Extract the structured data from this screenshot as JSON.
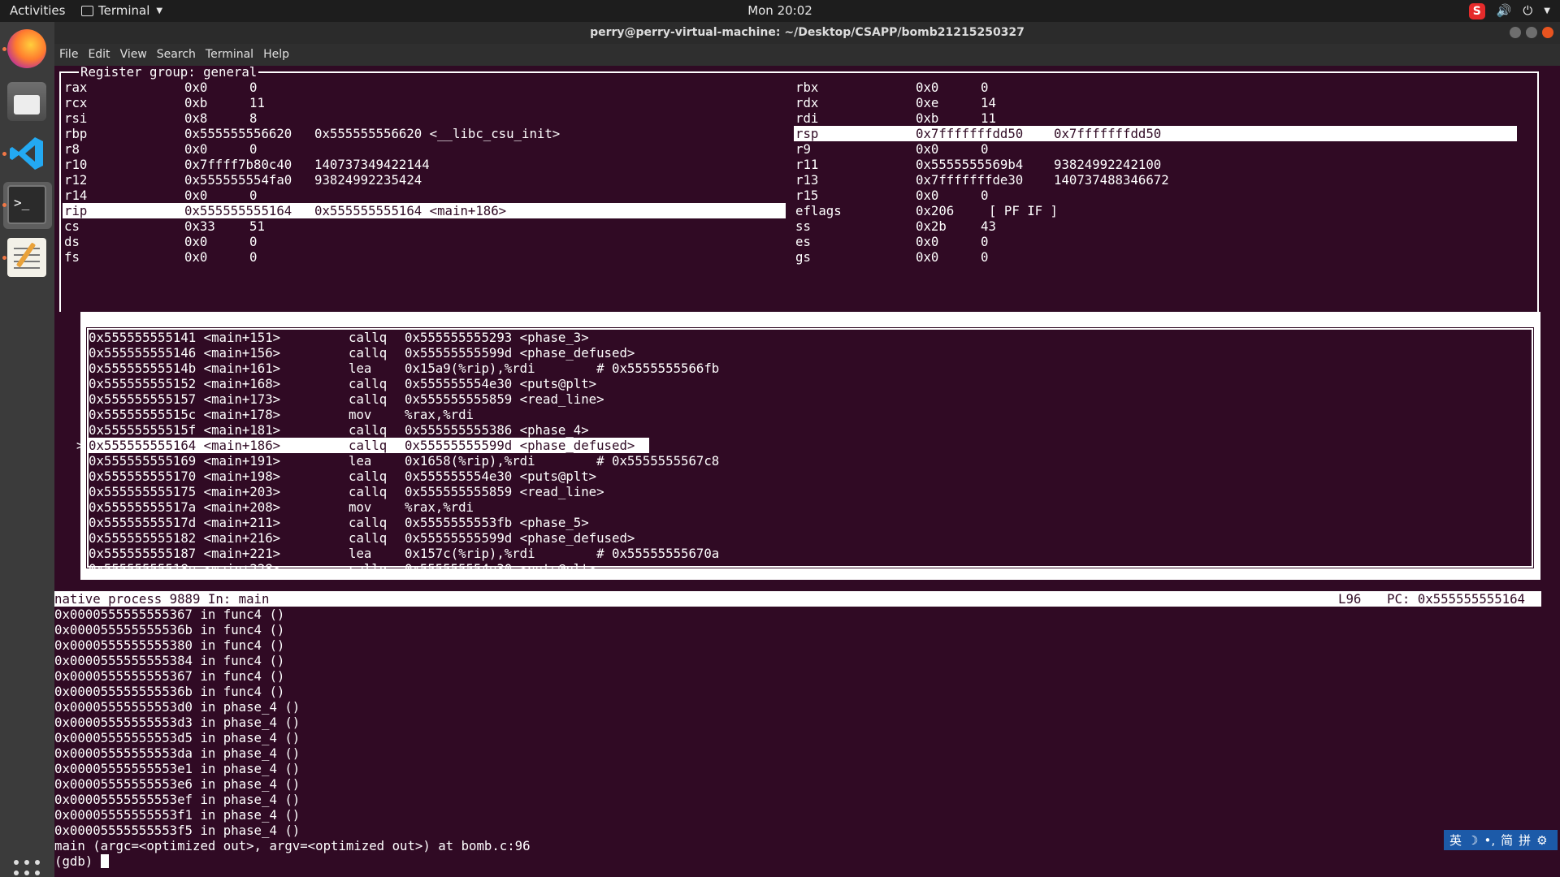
{
  "topbar": {
    "activities": "Activities",
    "app_menu": "Terminal",
    "clock": "Mon 20:02"
  },
  "window": {
    "title": "perry@perry-virtual-machine: ~/Desktop/CSAPP/bomb21215250327"
  },
  "menu": [
    "File",
    "Edit",
    "View",
    "Search",
    "Terminal",
    "Help"
  ],
  "registers": {
    "title": "Register group: general",
    "left": [
      {
        "name": "rax",
        "hex": "0x0",
        "val": "0"
      },
      {
        "name": "rcx",
        "hex": "0xb",
        "val": "11"
      },
      {
        "name": "rsi",
        "hex": "0x8",
        "val": "8"
      },
      {
        "name": "rbp",
        "hex": "0x555555556620",
        "val": "0x555555556620 <__libc_csu_init>"
      },
      {
        "name": "r8",
        "hex": "0x0",
        "val": "0"
      },
      {
        "name": "r10",
        "hex": "0x7ffff7b80c40",
        "val": "140737349422144"
      },
      {
        "name": "r12",
        "hex": "0x555555554fa0",
        "val": "93824992235424"
      },
      {
        "name": "r14",
        "hex": "0x0",
        "val": "0"
      },
      {
        "name": "rip",
        "hex": "0x555555555164",
        "val": "0x555555555164 <main+186>",
        "highlight": true
      },
      {
        "name": "cs",
        "hex": "0x33",
        "val": "51"
      },
      {
        "name": "ds",
        "hex": "0x0",
        "val": "0"
      },
      {
        "name": "fs",
        "hex": "0x0",
        "val": "0"
      }
    ],
    "right": [
      {
        "name": "rbx",
        "hex": "0x0",
        "val": "0"
      },
      {
        "name": "rdx",
        "hex": "0xe",
        "val": "14"
      },
      {
        "name": "rdi",
        "hex": "0xb",
        "val": "11"
      },
      {
        "name": "rsp",
        "hex": "0x7fffffffdd50",
        "val": "0x7fffffffdd50",
        "highlight": true
      },
      {
        "name": "r9",
        "hex": "0x0",
        "val": "0"
      },
      {
        "name": "r11",
        "hex": "0x5555555569b4",
        "val": "93824992242100"
      },
      {
        "name": "r13",
        "hex": "0x7fffffffde30",
        "val": "140737488346672"
      },
      {
        "name": "r15",
        "hex": "0x0",
        "val": "0"
      },
      {
        "name": "eflags",
        "hex": "0x206",
        "val": "[ PF IF ]"
      },
      {
        "name": "ss",
        "hex": "0x2b",
        "val": "43"
      },
      {
        "name": "es",
        "hex": "0x0",
        "val": "0"
      },
      {
        "name": "gs",
        "hex": "0x0",
        "val": "0"
      }
    ]
  },
  "asm": {
    "current_marker": ">",
    "lines": [
      {
        "addr": "0x555555555141 <main+151>",
        "op": "callq",
        "args": "0x555555555293 <phase_3>"
      },
      {
        "addr": "0x555555555146 <main+156>",
        "op": "callq",
        "args": "0x55555555599d <phase_defused>"
      },
      {
        "addr": "0x55555555514b <main+161>",
        "op": "lea",
        "args": "0x15a9(%rip),%rdi        # 0x5555555566fb"
      },
      {
        "addr": "0x555555555152 <main+168>",
        "op": "callq",
        "args": "0x555555554e30 <puts@plt>"
      },
      {
        "addr": "0x555555555157 <main+173>",
        "op": "callq",
        "args": "0x555555555859 <read_line>"
      },
      {
        "addr": "0x55555555515c <main+178>",
        "op": "mov",
        "args": "%rax,%rdi"
      },
      {
        "addr": "0x55555555515f <main+181>",
        "op": "callq",
        "args": "0x555555555386 <phase_4>"
      },
      {
        "addr": "0x555555555164 <main+186>",
        "op": "callq",
        "args": "0x55555555599d <phase_defused>",
        "current": true
      },
      {
        "addr": "0x555555555169 <main+191>",
        "op": "lea",
        "args": "0x1658(%rip),%rdi        # 0x5555555567c8"
      },
      {
        "addr": "0x555555555170 <main+198>",
        "op": "callq",
        "args": "0x555555554e30 <puts@plt>"
      },
      {
        "addr": "0x555555555175 <main+203>",
        "op": "callq",
        "args": "0x555555555859 <read_line>"
      },
      {
        "addr": "0x55555555517a <main+208>",
        "op": "mov",
        "args": "%rax,%rdi"
      },
      {
        "addr": "0x55555555517d <main+211>",
        "op": "callq",
        "args": "0x5555555553fb <phase_5>"
      },
      {
        "addr": "0x555555555182 <main+216>",
        "op": "callq",
        "args": "0x55555555599d <phase_defused>"
      },
      {
        "addr": "0x555555555187 <main+221>",
        "op": "lea",
        "args": "0x157c(%rip),%rdi        # 0x55555555670a"
      },
      {
        "addr": "0x55555555518e <main+228>",
        "op": "callq",
        "args": "0x555555554e30 <puts@plt>"
      }
    ]
  },
  "status": {
    "process": "native process 9889 In: main",
    "line": "L96",
    "pc": "PC: 0x555555555164"
  },
  "console": {
    "lines": [
      "0x0000555555555367 in func4 ()",
      "0x000055555555536b in func4 ()",
      "0x0000555555555380 in func4 ()",
      "0x0000555555555384 in func4 ()",
      "0x0000555555555367 in func4 ()",
      "0x000055555555536b in func4 ()",
      "0x00005555555553d0 in phase_4 ()",
      "0x00005555555553d3 in phase_4 ()",
      "0x00005555555553d5 in phase_4 ()",
      "0x00005555555553da in phase_4 ()",
      "0x00005555555553e1 in phase_4 ()",
      "0x00005555555553e6 in phase_4 ()",
      "0x00005555555553ef in phase_4 ()",
      "0x00005555555553f1 in phase_4 ()",
      "0x00005555555553f5 in phase_4 ()",
      "main (argc=<optimized out>, argv=<optimized out>) at bomb.c:96"
    ],
    "prompt": "(gdb) "
  },
  "ime": [
    "英",
    "☽",
    "•,",
    "简",
    "拼",
    "⚙"
  ],
  "colors": {
    "terminal_bg": "#300a24",
    "terminal_fg": "#ffffff",
    "accent": "#e95420"
  }
}
